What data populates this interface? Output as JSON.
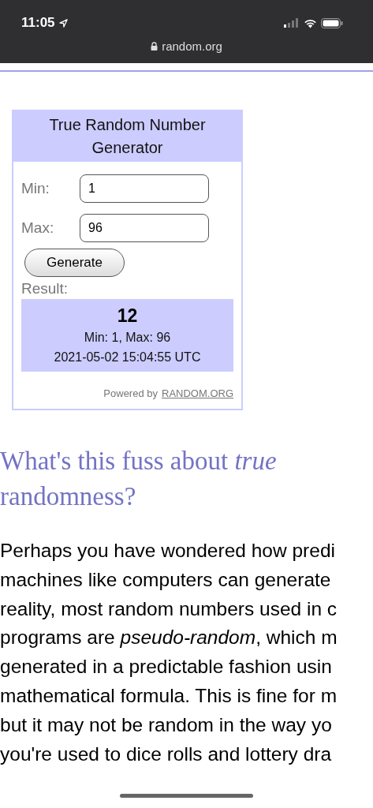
{
  "status_bar": {
    "time": "11:05",
    "url": "random.org"
  },
  "widget": {
    "title": "True Random Number Generator",
    "fields": [
      {
        "label": "Min:",
        "value": "1"
      },
      {
        "label": "Max:",
        "value": "96"
      }
    ],
    "button": "Generate",
    "result_label": "Result:",
    "result": {
      "number": "12",
      "range": "Min: 1, Max: 96",
      "timestamp": "2021-05-02 15:04:55 UTC"
    },
    "powered_by": "Powered by",
    "powered_link": "RANDOM.ORG"
  },
  "article": {
    "heading": "What's this fuss about *true* randomness?",
    "lines": [
      "Perhaps you have wondered how predi",
      "machines like computers can generate",
      "reality, most random numbers used in c",
      "programs are *pseudo-random*, which m",
      "generated in a predictable fashion usin",
      "mathematical formula. This is fine for m",
      "but it may not be random in the way yo",
      "you're used to dice rolls and lottery dra"
    ]
  }
}
